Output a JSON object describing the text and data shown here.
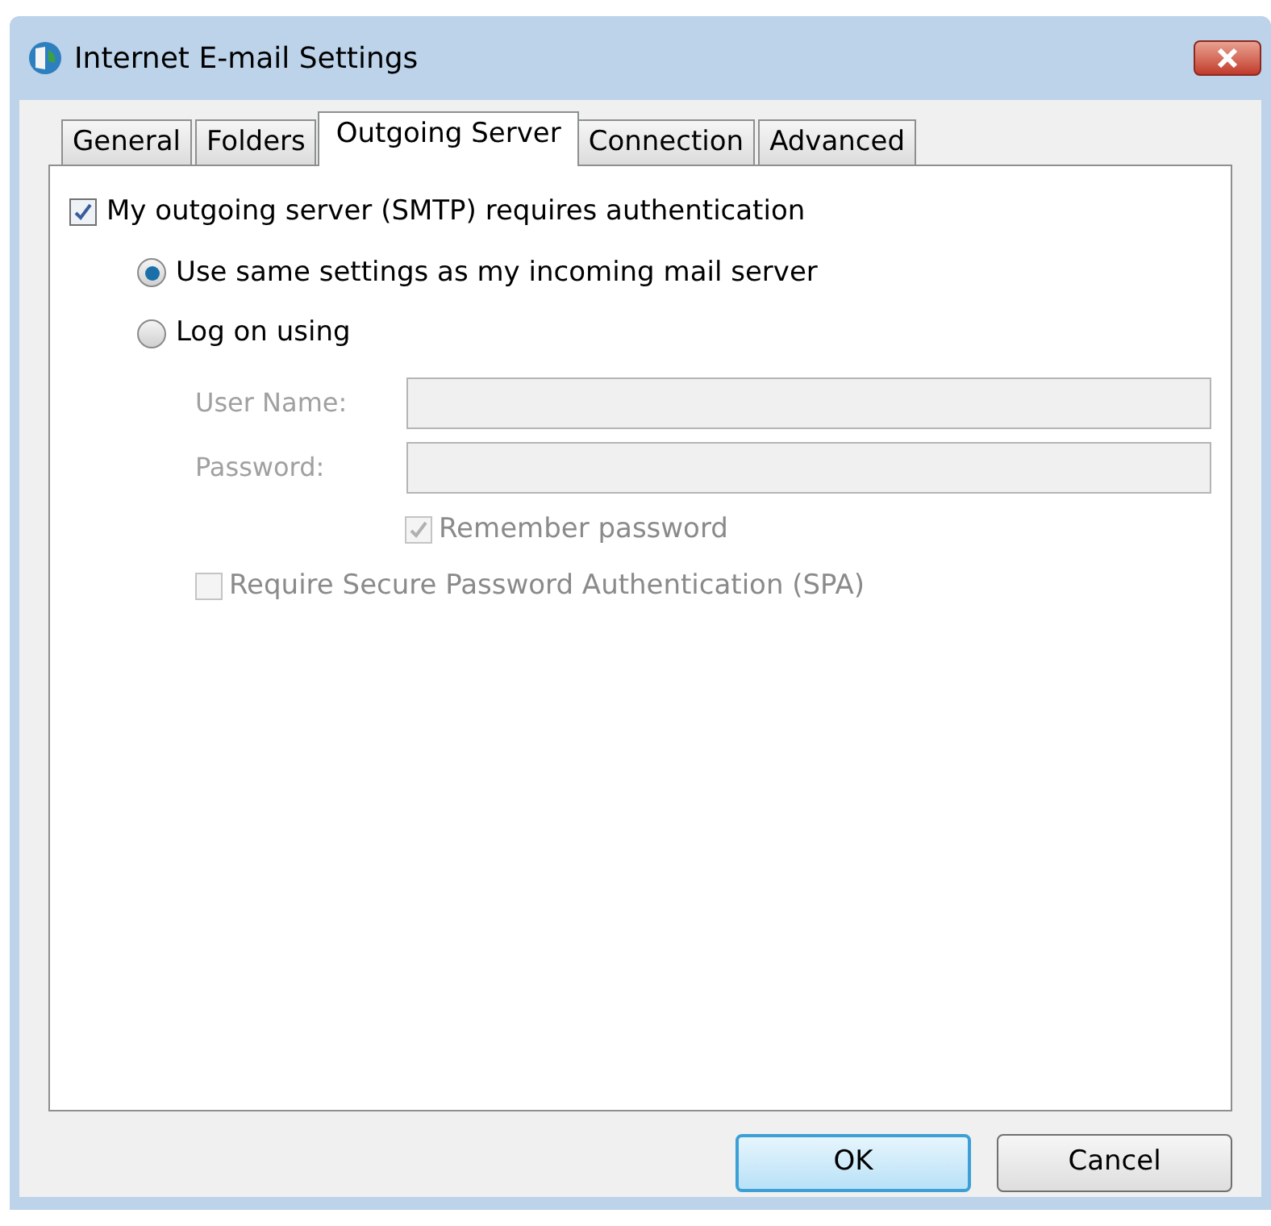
{
  "window": {
    "title": "Internet E-mail Settings"
  },
  "tabs": [
    {
      "label": "General",
      "selected": false
    },
    {
      "label": "Folders",
      "selected": false
    },
    {
      "label": "Outgoing Server",
      "selected": true
    },
    {
      "label": "Connection",
      "selected": false
    },
    {
      "label": "Advanced",
      "selected": false
    }
  ],
  "auth": {
    "label": "My outgoing server (SMTP) requires authentication",
    "checked": true
  },
  "radios": [
    {
      "label": "Use same settings as my incoming mail server",
      "selected": true
    },
    {
      "label": "Log on using",
      "selected": false
    }
  ],
  "fields": [
    {
      "label": "User Name:",
      "disabled": true
    },
    {
      "label": "Password:",
      "disabled": true
    }
  ],
  "remember": {
    "label": "Remember password",
    "checked": true,
    "disabled": true
  },
  "spa": {
    "label": "Require Secure Password Authentication (SPA)",
    "checked": false,
    "disabled": true
  },
  "buttons": [
    {
      "label": "OK",
      "default": true
    },
    {
      "label": "Cancel",
      "default": false
    }
  ]
}
